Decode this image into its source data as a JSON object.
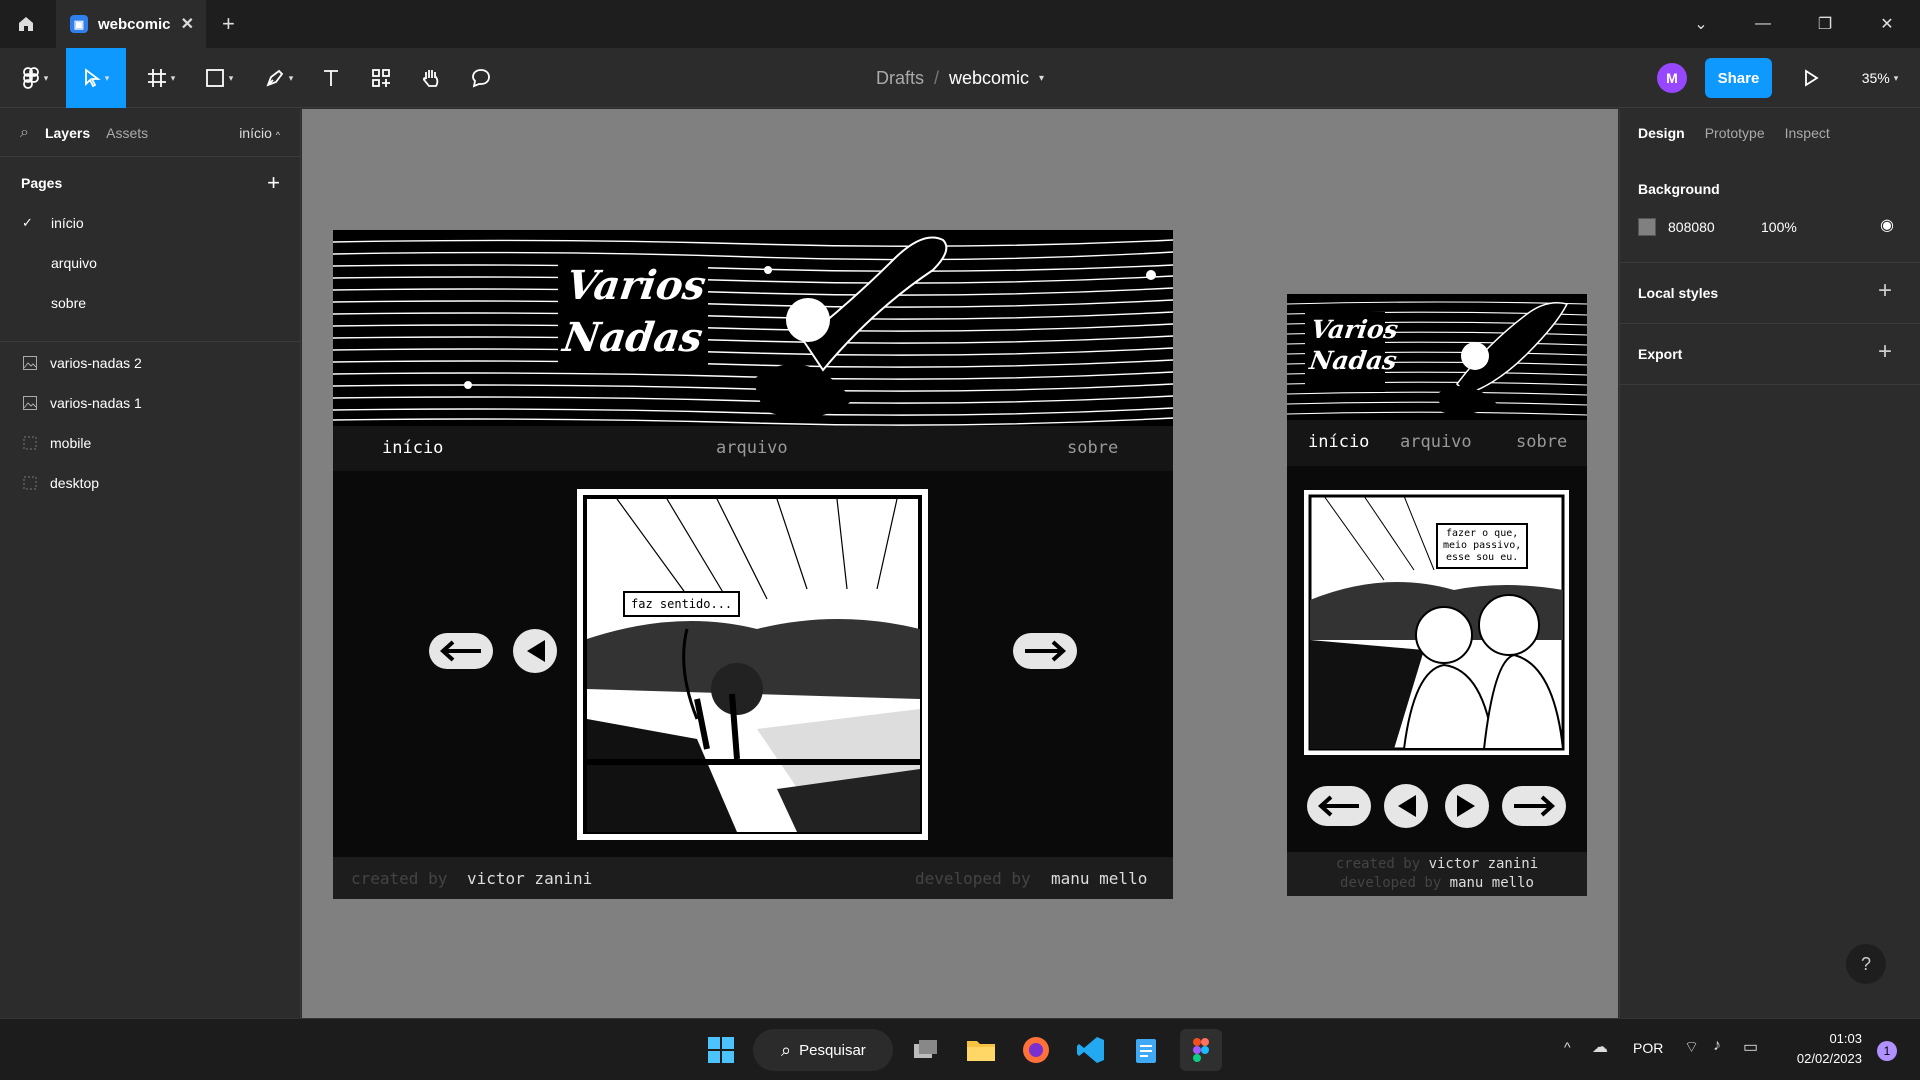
{
  "window": {
    "tab_title": "webcomic",
    "tab_close": "✕",
    "new_tab": "+"
  },
  "toolbar": {
    "breadcrumb_parent": "Drafts",
    "breadcrumb_sep": "/",
    "file_name": "webcomic",
    "avatar_initial": "M",
    "share_label": "Share",
    "zoom": "35%"
  },
  "left_panel": {
    "tab_layers": "Layers",
    "tab_assets": "Assets",
    "current_page": "início",
    "pages_heading": "Pages",
    "pages": [
      "início",
      "arquivo",
      "sobre"
    ],
    "layers": [
      {
        "name": "varios-nadas 2",
        "icon": "image-icon"
      },
      {
        "name": "varios-nadas 1",
        "icon": "image-icon"
      },
      {
        "name": "mobile",
        "icon": "frame-icon"
      },
      {
        "name": "desktop",
        "icon": "frame-icon"
      }
    ]
  },
  "right_panel": {
    "tab_design": "Design",
    "tab_prototype": "Prototype",
    "tab_inspect": "Inspect",
    "background_heading": "Background",
    "background_hex": "808080",
    "background_opacity": "100%",
    "local_styles": "Local styles",
    "export": "Export",
    "help": "?"
  },
  "desktop_frame": {
    "title_line1": "Varios",
    "title_line2": "Nadas",
    "nav": [
      "início",
      "arquivo",
      "sobre"
    ],
    "speech": "faz sentido...",
    "footer_created_label": "created by",
    "footer_created_name": "victor zanini",
    "footer_dev_label": "developed by",
    "footer_dev_name": "manu mello"
  },
  "mobile_frame": {
    "title_line1": "Varios",
    "title_line2": "Nadas",
    "nav": [
      "início",
      "arquivo",
      "sobre"
    ],
    "speech_lines": [
      "fazer o que,",
      "meio passivo,",
      "esse sou eu."
    ],
    "footer_created_label": "created by",
    "footer_created_name": "victor zanini",
    "footer_dev_label": "developed by",
    "footer_dev_name": "manu mello"
  },
  "taskbar": {
    "search_label": "Pesquisar",
    "language": "POR",
    "time": "01:03",
    "date": "02/02/2023",
    "notification_count": "1"
  },
  "colors": {
    "accent": "#0d99ff",
    "canvas_bg": "#808080",
    "avatar": "#9747ff"
  }
}
